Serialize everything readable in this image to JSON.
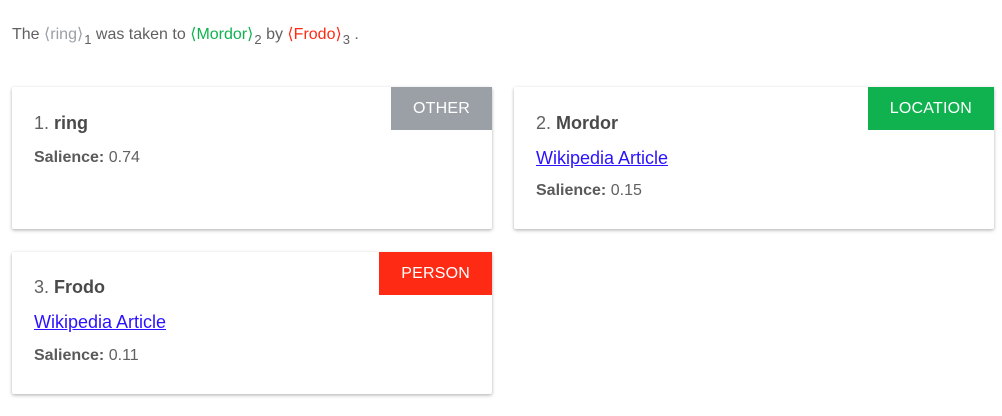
{
  "sentence": {
    "before": "The",
    "open_bracket": "⟨",
    "close_bracket": "⟩",
    "mid1": "was taken to",
    "mid2": "by",
    "end": ".",
    "mentions": [
      {
        "text": "ring",
        "index": "1"
      },
      {
        "text": "Mordor",
        "index": "2"
      },
      {
        "text": "Frodo",
        "index": "3"
      }
    ]
  },
  "entities": [
    {
      "number": "1.",
      "name": "ring",
      "type": "OTHER",
      "salience_label": "Salience:",
      "salience_value": "0.74"
    },
    {
      "number": "2.",
      "name": "Mordor",
      "type": "LOCATION",
      "link_text": "Wikipedia Article",
      "salience_label": "Salience:",
      "salience_value": "0.15"
    },
    {
      "number": "3.",
      "name": "Frodo",
      "type": "PERSON",
      "link_text": "Wikipedia Article",
      "salience_label": "Salience:",
      "salience_value": "0.11"
    }
  ],
  "colors": {
    "OTHER": "#9aa0a6",
    "LOCATION": "#0fb24f",
    "PERSON": "#ff2a14",
    "link": "#2b12ff"
  }
}
